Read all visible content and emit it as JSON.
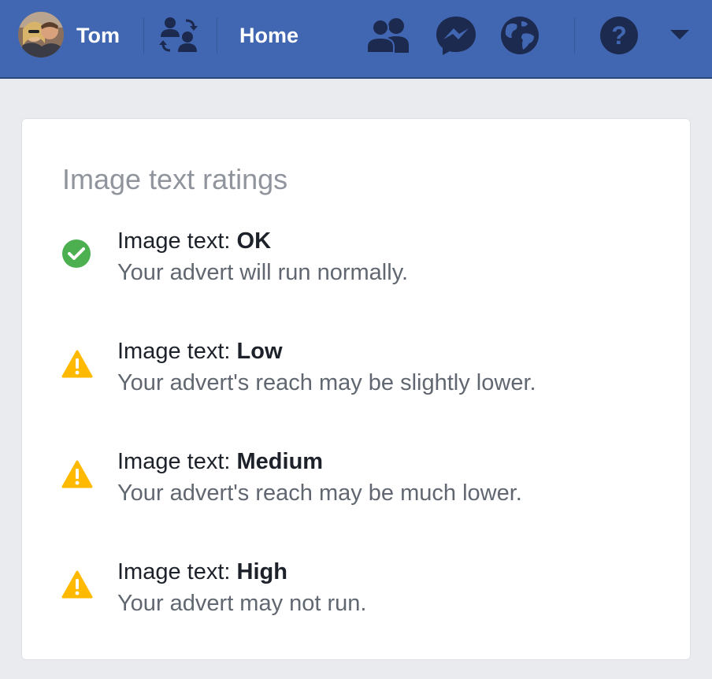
{
  "header": {
    "profile_name": "Tom",
    "home_label": "Home",
    "icons": [
      "avatar",
      "friends-switch-icon",
      "friend-requests-icon",
      "messenger-icon",
      "notifications-globe-icon",
      "help-icon",
      "dropdown-arrow-icon"
    ],
    "colors": {
      "bar": "#4267b2",
      "icon_dark": "#1d2a4f"
    }
  },
  "card": {
    "title": "Image text ratings",
    "ratings": [
      {
        "prefix": "Image text: ",
        "level": "OK",
        "description": "Your advert will run normally.",
        "icon": "check-circle-icon",
        "color": "#4caf50"
      },
      {
        "prefix": "Image text: ",
        "level": "Low",
        "description": "Your advert's reach may be slightly lower.",
        "icon": "warning-icon",
        "color": "#ffba00"
      },
      {
        "prefix": "Image text: ",
        "level": "Medium",
        "description": "Your advert's reach may be much lower.",
        "icon": "warning-icon",
        "color": "#ffba00"
      },
      {
        "prefix": "Image text: ",
        "level": "High",
        "description": "Your advert may not run.",
        "icon": "warning-icon",
        "color": "#ffba00"
      }
    ]
  }
}
